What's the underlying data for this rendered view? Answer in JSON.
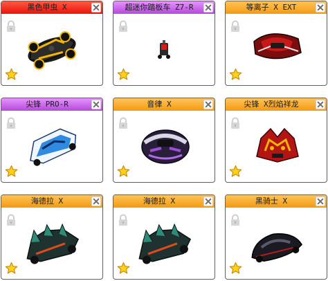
{
  "cards": [
    {
      "name": "黑色甲虫 X",
      "header_color": "#ef2a16",
      "icons": [
        "close-icon",
        "lock-icon",
        "star-icon"
      ]
    },
    {
      "name": "超迷你踏板车 Z7-R",
      "header_color": "#c35ee6",
      "icons": [
        "close-icon",
        "lock-icon",
        "star-icon"
      ]
    },
    {
      "name": "等离子 X EXT",
      "header_color": "#f6a627",
      "icons": [
        "close-icon",
        "lock-icon",
        "star-icon"
      ]
    },
    {
      "name": "尖锋 PRO-R",
      "header_color": "#c35ee6",
      "icons": [
        "close-icon",
        "lock-icon",
        "star-icon"
      ]
    },
    {
      "name": "音律 X",
      "header_color": "#f6a627",
      "icons": [
        "close-icon",
        "lock-icon",
        "star-icon"
      ]
    },
    {
      "name": "尖锋 X烈焰祥龙",
      "header_color": "#f6a627",
      "icons": [
        "close-icon",
        "lock-icon",
        "star-icon"
      ]
    },
    {
      "name": "海德拉 X",
      "header_color": "#f6a627",
      "icons": [
        "close-icon",
        "lock-icon",
        "star-icon"
      ]
    },
    {
      "name": "海德拉 X",
      "header_color": "#f6a627",
      "icons": [
        "close-icon",
        "lock-icon",
        "star-icon"
      ]
    },
    {
      "name": "黑骑士 X",
      "header_color": "#f6a627",
      "icons": [
        "close-icon",
        "lock-icon",
        "star-icon"
      ]
    }
  ]
}
